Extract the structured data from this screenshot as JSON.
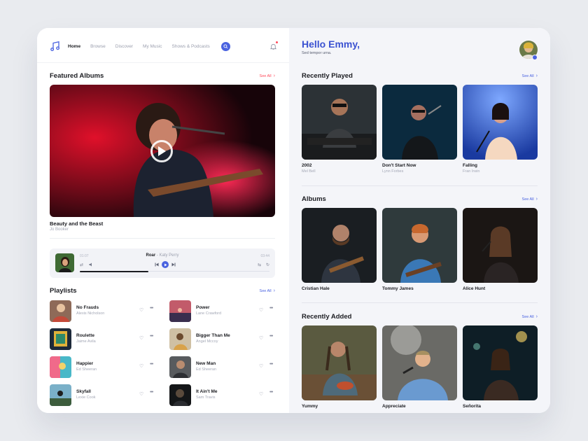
{
  "nav": {
    "items": [
      {
        "label": "Home",
        "active": true
      },
      {
        "label": "Browse",
        "active": false
      },
      {
        "label": "Discover",
        "active": false
      },
      {
        "label": "My Music",
        "active": false
      },
      {
        "label": "Shows & Podcasts",
        "active": false
      }
    ],
    "icons": {
      "logo": "music-note-icon",
      "search": "search-icon",
      "notifications": "bell-icon"
    }
  },
  "featured": {
    "title": "Featured Albums",
    "see_all": "See All",
    "album": {
      "title": "Beauty and the Beast",
      "artist": "Jo Booker"
    }
  },
  "player": {
    "elapsed": "01:07",
    "duration": "03:44",
    "song": "Roar",
    "separator": " - ",
    "artist": "Katy Perry",
    "progress": 0.36
  },
  "playlists": {
    "title": "Playlists",
    "see_all": "See All",
    "items": [
      {
        "name": "No Frauds",
        "artist": "Alexis Nicholson"
      },
      {
        "name": "Power",
        "artist": "Lane Crawford"
      },
      {
        "name": "Roulette",
        "artist": "Jaime Avila"
      },
      {
        "name": "Bigger Than Me",
        "artist": "Angel Mccoy"
      },
      {
        "name": "Happier",
        "artist": "Ed Sheeran"
      },
      {
        "name": "New Man",
        "artist": "Ed Sheeran"
      },
      {
        "name": "Skyfall",
        "artist": "Lexie Cook"
      },
      {
        "name": "It Ain't Me",
        "artist": "Sam Travis"
      }
    ]
  },
  "greeting": {
    "title": "Hello Emmy,",
    "subtitle": "Sed tempor urna."
  },
  "recently_played": {
    "title": "Recently Played",
    "see_all": "See All",
    "items": [
      {
        "title": "2002",
        "artist": "Mel Bell"
      },
      {
        "title": "Don't Start Now",
        "artist": "Lynn Forbes"
      },
      {
        "title": "Falling",
        "artist": "Fran Irwin"
      }
    ]
  },
  "albums": {
    "title": "Albums",
    "see_all": "See All",
    "items": [
      {
        "title": "Cristian Hale"
      },
      {
        "title": "Tommy James"
      },
      {
        "title": "Alice Hunt"
      }
    ]
  },
  "recently_added": {
    "title": "Recently Added",
    "see_all": "See All",
    "items": [
      {
        "title": "Yummy"
      },
      {
        "title": "Appreciate"
      },
      {
        "title": "Señorita"
      }
    ]
  },
  "colors": {
    "accent": "#4a63e0",
    "see_all_red": "#ff4b5c",
    "greeting_blue": "#3b52d1"
  }
}
